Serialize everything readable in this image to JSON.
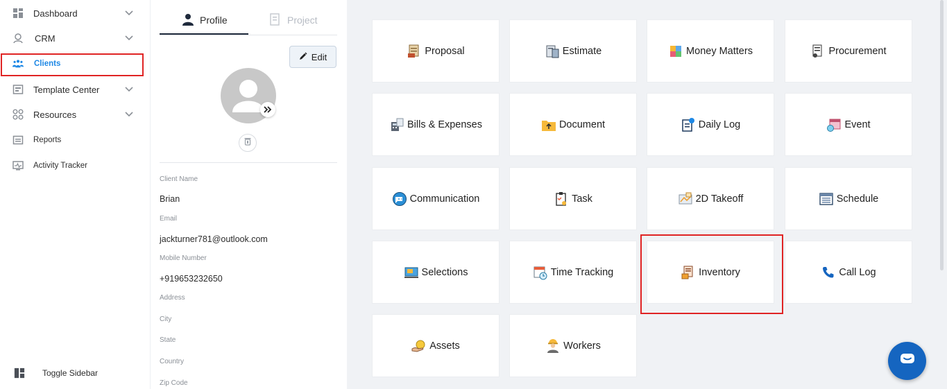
{
  "sidebar": {
    "items": [
      {
        "label": "Dashboard",
        "icon": "dashboard-icon",
        "has_chevron": true
      },
      {
        "label": "CRM",
        "icon": "crm-icon",
        "has_chevron": true
      },
      {
        "label": "Clients",
        "icon": "clients-icon",
        "has_chevron": false,
        "active": true
      },
      {
        "label": "Template Center",
        "icon": "template-icon",
        "has_chevron": true
      },
      {
        "label": "Resources",
        "icon": "resources-icon",
        "has_chevron": true
      },
      {
        "label": "Reports",
        "icon": "reports-icon",
        "has_chevron": false
      },
      {
        "label": "Activity Tracker",
        "icon": "activity-icon",
        "has_chevron": false
      }
    ],
    "toggle_label": "Toggle Sidebar"
  },
  "profile": {
    "tabs": {
      "profile": "Profile",
      "project": "Project"
    },
    "edit_label": "Edit",
    "fields": {
      "client_name_label": "Client Name",
      "client_name": "Brian",
      "email_label": "Email",
      "email": "jackturner781@outlook.com",
      "mobile_label": "Mobile Number",
      "mobile": "+919653232650",
      "address_label": "Address",
      "city_label": "City",
      "state_label": "State",
      "country_label": "Country",
      "zip_label": "Zip Code"
    }
  },
  "modules": [
    {
      "label": "Proposal",
      "icon": "proposal-icon"
    },
    {
      "label": "Estimate",
      "icon": "estimate-icon"
    },
    {
      "label": "Money Matters",
      "icon": "money-icon"
    },
    {
      "label": "Procurement",
      "icon": "procurement-icon"
    },
    {
      "label": "Bills & Expenses",
      "icon": "bills-icon"
    },
    {
      "label": "Document",
      "icon": "document-icon"
    },
    {
      "label": "Daily Log",
      "icon": "daily-log-icon"
    },
    {
      "label": "Event",
      "icon": "event-icon"
    },
    {
      "label": "Communication",
      "icon": "communication-icon"
    },
    {
      "label": "Task",
      "icon": "task-icon"
    },
    {
      "label": "2D Takeoff",
      "icon": "takeoff-icon"
    },
    {
      "label": "Schedule",
      "icon": "schedule-icon"
    },
    {
      "label": "Selections",
      "icon": "selections-icon"
    },
    {
      "label": "Time Tracking",
      "icon": "time-tracking-icon"
    },
    {
      "label": "Inventory",
      "icon": "inventory-icon"
    },
    {
      "label": "Call Log",
      "icon": "call-log-icon"
    },
    {
      "label": "Assets",
      "icon": "assets-icon"
    },
    {
      "label": "Workers",
      "icon": "workers-icon"
    }
  ],
  "colors": {
    "accent": "#1e88e5",
    "highlight": "#e02424",
    "chat": "#1565c0"
  }
}
